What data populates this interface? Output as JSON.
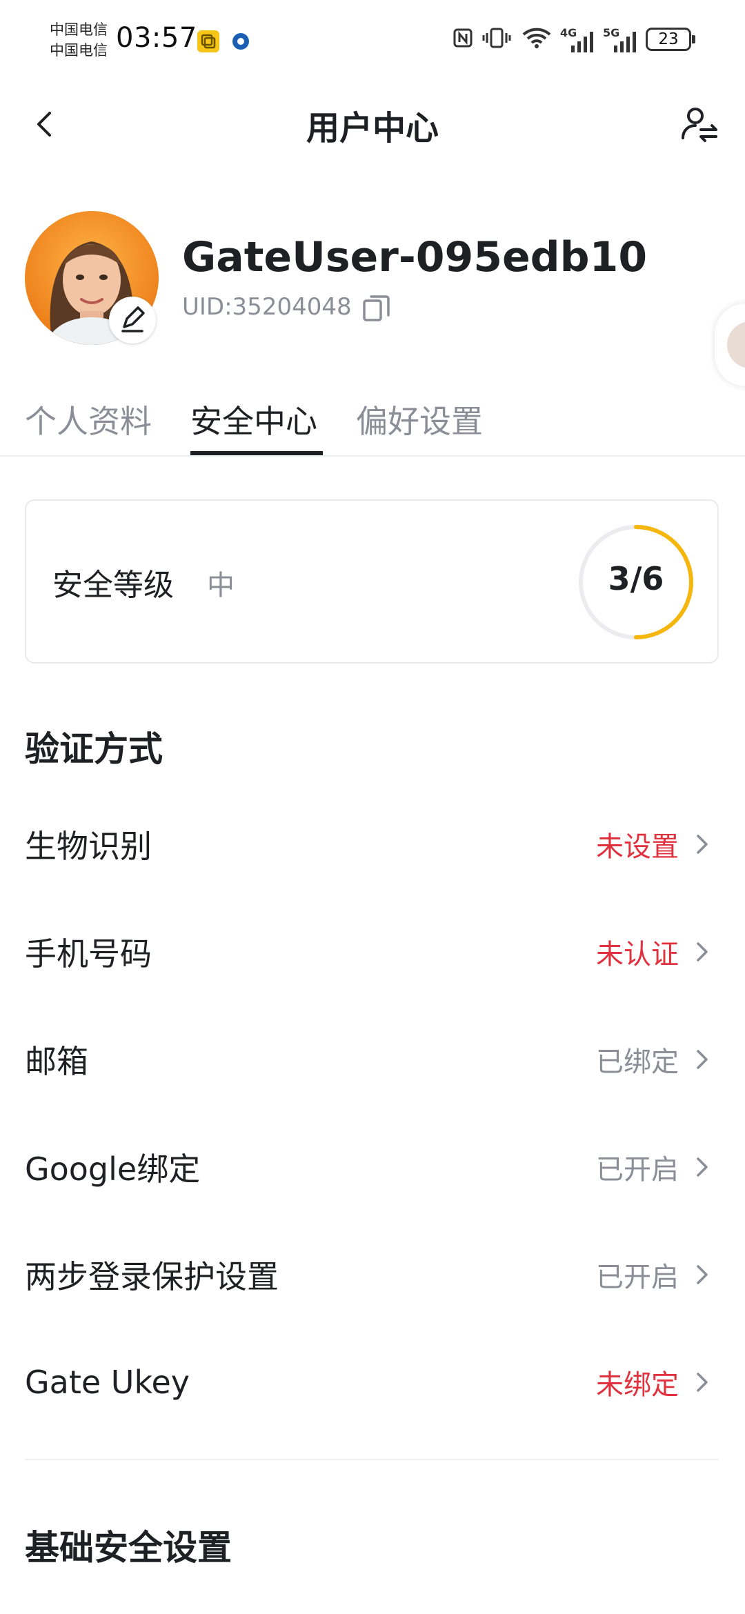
{
  "status_bar": {
    "carrier_1": "中国电信",
    "carrier_2": "中国电信",
    "time": "03:57",
    "network_1": "4G",
    "network_2": "5G",
    "battery": "23"
  },
  "header": {
    "title": "用户中心",
    "back_icon": "chevron-left-icon",
    "switch_icon": "switch-user-icon"
  },
  "profile": {
    "username": "GateUser-095edb10",
    "uid": "UID:35204048"
  },
  "tabs": [
    {
      "label": "个人资料",
      "active": false
    },
    {
      "label": "安全中心",
      "active": true
    },
    {
      "label": "偏好设置",
      "active": false
    }
  ],
  "security_card": {
    "label": "安全等级",
    "level": "中",
    "score_text": "3/6",
    "score": 3,
    "score_max": 6,
    "ring_color": "#f5b70d",
    "ring_track_color": "#ececef"
  },
  "verification": {
    "title": "验证方式",
    "items": [
      {
        "label": "生物识别",
        "status": "未设置",
        "state": "warn"
      },
      {
        "label": "手机号码",
        "status": "未认证",
        "state": "warn"
      },
      {
        "label": "邮箱",
        "status": "已绑定",
        "state": "ok"
      },
      {
        "label": "Google绑定",
        "status": "已开启",
        "state": "ok"
      },
      {
        "label": "两步登录保护设置",
        "status": "已开启",
        "state": "ok"
      },
      {
        "label": "Gate Ukey",
        "status": "未绑定",
        "state": "warn"
      }
    ]
  },
  "basic_security": {
    "title": "基础安全设置"
  },
  "colors": {
    "warn": "#e0313e",
    "muted": "#8b8e96",
    "text": "#1f2024"
  }
}
